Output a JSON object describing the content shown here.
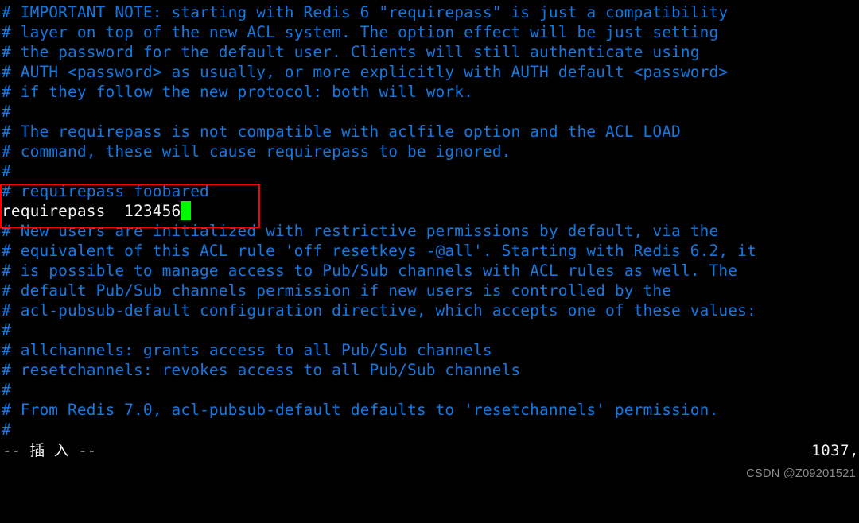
{
  "terminal": {
    "background": "#000000",
    "comment_color": "#1577e0",
    "active_color": "#f2f2f2",
    "cursor_color": "#00f900",
    "highlight_color": "#ff0000"
  },
  "buffer": {
    "lines": [
      {
        "text": "# IMPORTANT NOTE: starting with Redis 6 \"requirepass\" is just a compatibility",
        "style": "comment"
      },
      {
        "text": "# layer on top of the new ACL system. The option effect will be just setting",
        "style": "comment"
      },
      {
        "text": "# the password for the default user. Clients will still authenticate using",
        "style": "comment"
      },
      {
        "text": "# AUTH <password> as usually, or more explicitly with AUTH default <password>",
        "style": "comment"
      },
      {
        "text": "# if they follow the new protocol: both will work.",
        "style": "comment"
      },
      {
        "text": "#",
        "style": "comment"
      },
      {
        "text": "# The requirepass is not compatible with aclfile option and the ACL LOAD",
        "style": "comment"
      },
      {
        "text": "# command, these will cause requirepass to be ignored.",
        "style": "comment"
      },
      {
        "text": "#",
        "style": "comment"
      },
      {
        "text": "# requirepass foobared",
        "style": "comment"
      },
      {
        "text": "requirepass  123456",
        "style": "active",
        "cursor": true
      },
      {
        "text": "# New users are initialized with restrictive permissions by default, via the",
        "style": "comment"
      },
      {
        "text": "# equivalent of this ACL rule 'off resetkeys -@all'. Starting with Redis 6.2, it",
        "style": "comment"
      },
      {
        "text": "# is possible to manage access to Pub/Sub channels with ACL rules as well. The",
        "style": "comment"
      },
      {
        "text": "# default Pub/Sub channels permission if new users is controlled by the",
        "style": "comment"
      },
      {
        "text": "# acl-pubsub-default configuration directive, which accepts one of these values:",
        "style": "comment"
      },
      {
        "text": "#",
        "style": "comment"
      },
      {
        "text": "# allchannels: grants access to all Pub/Sub channels",
        "style": "comment"
      },
      {
        "text": "# resetchannels: revokes access to all Pub/Sub channels",
        "style": "comment"
      },
      {
        "text": "#",
        "style": "comment"
      },
      {
        "text": "# From Redis 7.0, acl-pubsub-default defaults to 'resetchannels' permission.",
        "style": "comment"
      },
      {
        "text": "#",
        "style": "comment"
      }
    ]
  },
  "highlight": {
    "label": "requirepass-highlight-box"
  },
  "status": {
    "mode": "-- 插 入 --",
    "position": "1037,"
  },
  "watermark": {
    "text": "CSDN @Z09201521"
  }
}
